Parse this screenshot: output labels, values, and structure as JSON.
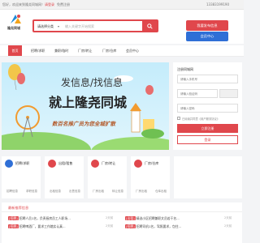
{
  "topbar": {
    "welcome": "您好，欢迎来到隆尧同城网！",
    "login": "请登录",
    "register": "免费注册",
    "phone": "13383199190"
  },
  "header": {
    "logo_text": "隆尧同城",
    "category": "请选择分类",
    "search_placeholder": "输入关键字开始搜索",
    "publish_button": "我要发布信息",
    "member_button": "会员中心"
  },
  "nav": {
    "items": [
      "首页",
      "招聘/求职",
      "兼职/临时",
      "厂房/转让",
      "厂房/仓库",
      "会员中心"
    ]
  },
  "banner": {
    "line1": "发信息/找信息",
    "line2": "就上隆尧同城",
    "line3": "数百名推广员为您全城扩散"
  },
  "login_form": {
    "title": "注册同城网",
    "phone_placeholder": "请输入手机号",
    "code_placeholder": "请输入验证码",
    "pwd_placeholder": "请输入密码",
    "agree": "已阅读并同意《用户服务协议》",
    "register_button": "立即注册",
    "login_button": "登录"
  },
  "cards": [
    {
      "label": "招聘/求职",
      "color": "#2f6fd6",
      "sub1": "招聘信息",
      "sub2": "求职信息"
    },
    {
      "label": "出租/租售",
      "color": "#e0474c",
      "sub1": "出租信息",
      "sub2": "出售信息"
    },
    {
      "label": "厂房/转让",
      "color": "#e0474c",
      "sub1": "厂房出租",
      "sub2": "转让信息"
    },
    {
      "label": "厂房/仓库",
      "color": "#e0474c",
      "sub1": "厂房出租",
      "sub2": "仓库出租"
    }
  ],
  "recommend": {
    "title": "最新推荐信息",
    "items": [
      {
        "tag": "[招聘]",
        "text": "招聘人员1名，负责厨房员工人职场...",
        "time": "2天前"
      },
      {
        "tag": "[招聘]",
        "text": "招聘啤酒厂，要求工作踏实认真...",
        "time": "2天前"
      },
      {
        "tag": "[出租]",
        "text": "精选小区招聘兼职文员若干名...",
        "time": "2天前"
      },
      {
        "tag": "[招聘]",
        "text": "招聘司机1名，驾照要求，包住...",
        "time": "2天前"
      }
    ]
  }
}
